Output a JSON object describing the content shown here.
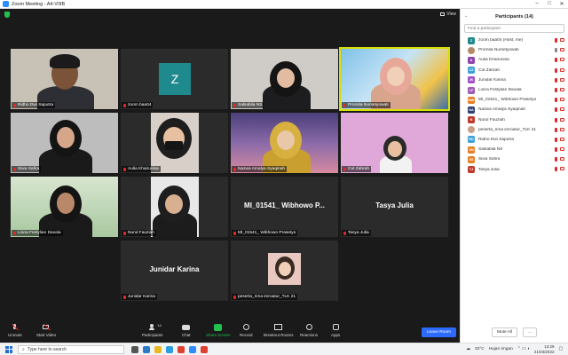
{
  "window": {
    "title": "Zoom Meeting - A4-VIIIB",
    "view_label": "View"
  },
  "tiles": [
    {
      "name": "Ridho Dwi Saputra"
    },
    {
      "name": "zoom baa04",
      "avatar": "Z"
    },
    {
      "name": "Salsabila NS"
    },
    {
      "name": "Promita Nursetyowati"
    },
    {
      "name": "Siwa Safira"
    },
    {
      "name": "Aulia Khairunisa"
    },
    {
      "name": "Nazwa Amalya Syaqinah"
    },
    {
      "name": "Cut Zahrah"
    },
    {
      "name": "Liona Festylian Davala"
    },
    {
      "name": "Nurul Fauziah"
    },
    {
      "name": "MI_01541_ Wibhowo Prasetyo",
      "big": "MI_01541_ Wibhowo P..."
    },
    {
      "name": "Tasya Julia",
      "big": "Tasya Julia"
    },
    {
      "name": "Junidar Karina",
      "big": "Junidar Karina"
    },
    {
      "name": "peserta_rima imroatur_TLK 21"
    }
  ],
  "toolbar": {
    "unmute": "Unmute",
    "start_video": "Start Video",
    "participants": "Participants",
    "participants_count": "14",
    "chat": "Chat",
    "share_screen": "Share Screen",
    "record": "Record",
    "breakout": "Breakout Rooms",
    "reactions": "Reactions",
    "apps": "Apps",
    "leave": "Leave Room"
  },
  "panel": {
    "title": "Participants (14)",
    "search_placeholder": "Find a participant",
    "participants": [
      {
        "initials": "Z",
        "name": "zoom baa04 (Host, me)",
        "color": "#1f8a8e"
      },
      {
        "initials": "",
        "name": "Promita Nursetyowati",
        "color": "#b38a6a",
        "photo": true
      },
      {
        "initials": "A",
        "name": "Aulia Khairunisa",
        "color": "#8e44ad"
      },
      {
        "initials": "CZ",
        "name": "Cut Zahrah",
        "color": "#3aa0d8"
      },
      {
        "initials": "JK",
        "name": "Junidar Karina",
        "color": "#a050c8"
      },
      {
        "initials": "LF",
        "name": "Liona Festylian Davala",
        "color": "#9b59b6"
      },
      {
        "initials": "MW",
        "name": "MI_01541_ Wibhowo Prasetyo",
        "color": "#e67e22"
      },
      {
        "initials": "NA",
        "name": "Nazwa Amalya Syaqinah",
        "color": "#2c3e70"
      },
      {
        "initials": "N",
        "name": "Nurul Fauziah",
        "color": "#c0392b"
      },
      {
        "initials": "",
        "name": "peserta_rima imroatur_TLK 21",
        "color": "#c9a08a",
        "photo": true
      },
      {
        "initials": "RD",
        "name": "Ridho Dwi Saputra",
        "color": "#3aa0d8"
      },
      {
        "initials": "SN",
        "name": "Salsabila NS",
        "color": "#e67e22"
      },
      {
        "initials": "SS",
        "name": "Siwa Safira",
        "color": "#e67e22"
      },
      {
        "initials": "TJ",
        "name": "Tasya Julia",
        "color": "#c0392b"
      }
    ],
    "mute_all": "Mute All",
    "more": "..."
  },
  "taskbar": {
    "search_placeholder": "Type here to search",
    "temperature": "33°C",
    "weather": "Hujan ringan",
    "time": "13:29",
    "date": "21/03/2022"
  }
}
